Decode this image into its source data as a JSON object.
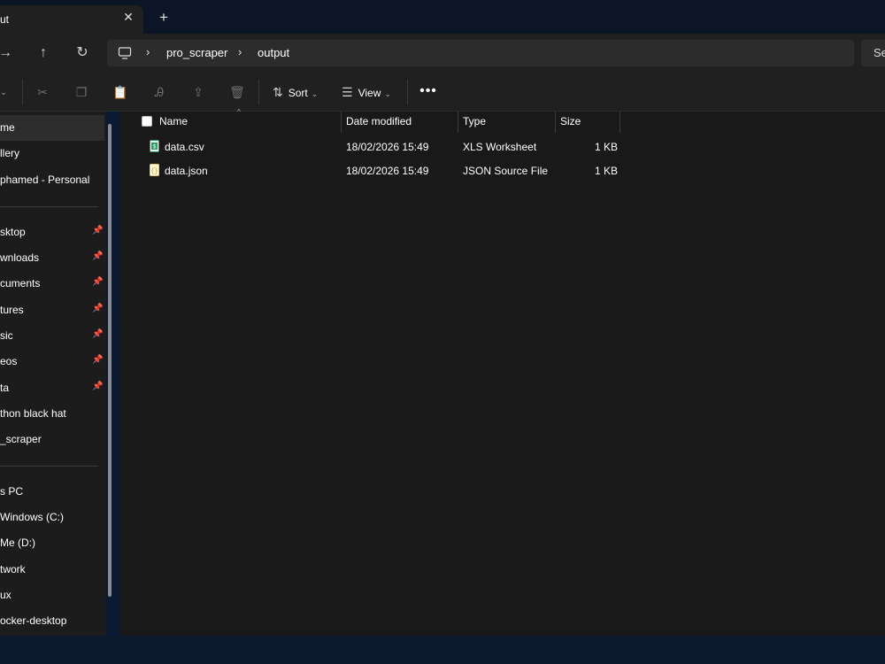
{
  "window": {
    "tab_title": "ut",
    "tab_close": "✕",
    "new_tab": "+"
  },
  "nav": {
    "forward": "→",
    "up": "↑",
    "refresh": "↻",
    "breadcrumb": [
      "pro_scraper",
      "output"
    ],
    "search_label": "Se"
  },
  "toolbar": {
    "sort_label": "Sort",
    "view_label": "View",
    "more_label": "•••"
  },
  "sidebar": {
    "items": [
      {
        "label": "me",
        "pinned": false
      },
      {
        "label": "llery",
        "pinned": false
      },
      {
        "label": "phamed - Personal",
        "pinned": false
      },
      {
        "label": "sktop",
        "pinned": true
      },
      {
        "label": "wnloads",
        "pinned": true
      },
      {
        "label": "cuments",
        "pinned": true
      },
      {
        "label": "tures",
        "pinned": true
      },
      {
        "label": "sic",
        "pinned": true
      },
      {
        "label": "eos",
        "pinned": true
      },
      {
        "label": "ta",
        "pinned": true
      },
      {
        "label": "thon black hat",
        "pinned": false
      },
      {
        "label": "_scraper",
        "pinned": false
      },
      {
        "label": "s PC",
        "pinned": false
      },
      {
        "label": "Windows (C:)",
        "pinned": false
      },
      {
        "label": "Me (D:)",
        "pinned": false
      },
      {
        "label": "twork",
        "pinned": false
      },
      {
        "label": "ux",
        "pinned": false
      },
      {
        "label": "ocker-desktop",
        "pinned": false
      }
    ]
  },
  "columns": {
    "name": "Name",
    "date_modified": "Date modified",
    "type": "Type",
    "size": "Size"
  },
  "files": [
    {
      "name": "data.csv",
      "date_modified": "18/02/2026 15:49",
      "type": "XLS Worksheet",
      "size": "1 KB",
      "icon": "spreadsheet-file-icon",
      "icon_color": "#21a366"
    },
    {
      "name": "data.json",
      "date_modified": "18/02/2026 15:49",
      "type": "JSON Source File",
      "size": "1 KB",
      "icon": "json-file-icon",
      "icon_color": "#e8c94a"
    }
  ],
  "colors": {
    "background": "#191919",
    "toolbar": "#202020",
    "sidebar_selected": "#2d2d2d"
  }
}
